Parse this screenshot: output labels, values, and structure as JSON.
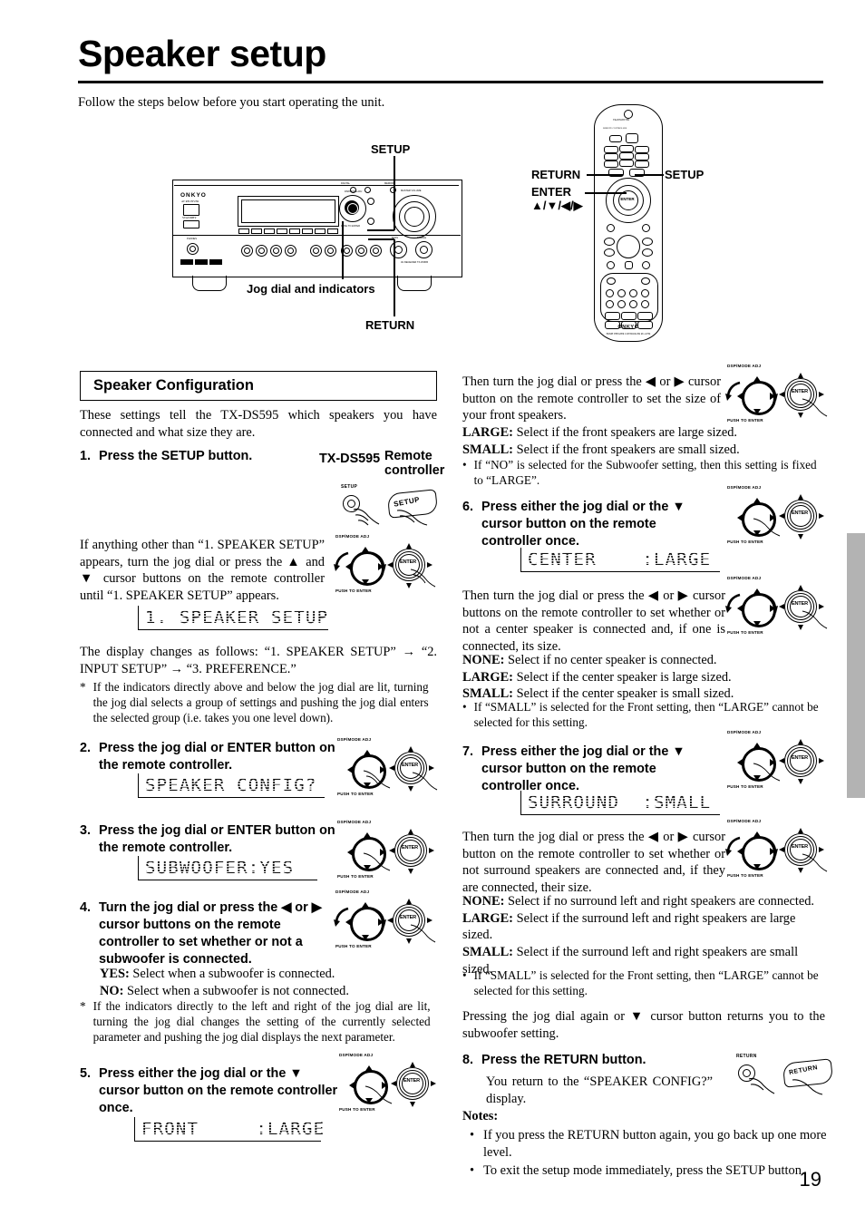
{
  "document": {
    "title": "Speaker setup",
    "intro": "Follow the steps below before you start operating the unit.",
    "page_number": "19"
  },
  "diagrams": {
    "receiver": {
      "brand": "ONKYO",
      "model": "TX-DS595",
      "callout_setup": "SETUP",
      "callout_jog": "Jog dial and indicators",
      "callout_return": "RETURN"
    },
    "remote": {
      "brand": "ONKYO",
      "callout_return": "RETURN",
      "callout_enter": "ENTER",
      "callout_cursor": "▲/▼/◀/▶",
      "callout_setup": "SETUP"
    },
    "jog_icon": {
      "top_label": "DSP/MODE ADJ",
      "bottom_label": "PUSH TO ENTER",
      "enter_label": "ENTER"
    },
    "setup_button_icon": {
      "label": "SETUP",
      "keycap": "SETUP"
    },
    "return_button_icon": {
      "label": "RETURN",
      "keycap": "RETURN"
    }
  },
  "left_column": {
    "section_header": "Speaker Configuration",
    "section_intro": "These settings tell the TX-DS595 which speakers you have connected and what size they are.",
    "device_label": "TX-DS595",
    "remote_label_line1": "Remote",
    "remote_label_line2": "controller",
    "step1": {
      "number": "1.",
      "heading": "Press the SETUP button.",
      "body": "If anything other than “1. SPEAKER SETUP” appears, turn the jog dial or press the ▲ and ▼ cursor buttons on the remote controller until “1. SPEAKER SETUP” appears.",
      "display": "1. SPEAKER SETUP",
      "after1": "The display changes as follows: “1. SPEAKER SETUP” → “2. INPUT SETUP” → “3. PREFERENCE.”",
      "after2_marker": "*",
      "after2": "If the indicators directly above and below the jog dial are lit, turning the jog dial selects a group of settings and pushing the jog dial enters the selected group (i.e. takes you one level down)."
    },
    "step2": {
      "number": "2.",
      "heading": "Press the jog dial or ENTER button on the remote controller.",
      "display": "SPEAKER CONFIG?"
    },
    "step3": {
      "number": "3.",
      "heading": "Press the jog dial or ENTER button on the remote controller.",
      "display": "SUBWOOFER:YES"
    },
    "step4": {
      "number": "4.",
      "heading": "Turn the jog dial or press the ◀ or ▶ cursor buttons on the remote controller to set whether or not a subwoofer is connected.",
      "opt1_key": "YES:",
      "opt1_text": " Select when a subwoofer is connected.",
      "opt2_key": "NO:",
      "opt2_text": " Select when a subwoofer is not connected.",
      "note_marker": "*",
      "note": "If the indicators directly to the left and right of the jog dial are lit, turning the jog dial changes the setting of the currently selected parameter and pushing the jog dial displays the next parameter."
    },
    "step5": {
      "number": "5.",
      "heading": "Press either the jog dial or the ▼ cursor button on the remote controller once.",
      "display": "FRONT     :LARGE"
    }
  },
  "right_column": {
    "front": {
      "body": "Then turn the jog dial or press the ◀ or ▶ cursor button on the remote controller to set the size of your front speakers.",
      "opt1_key": "LARGE:",
      "opt1_text": " Select if the front speakers are large sized.",
      "opt2_key": "SMALL:",
      "opt2_text": " Select if the front speakers are small sized.",
      "bullet": "If “NO” is selected for the Subwoofer setting, then this setting is fixed to “LARGE”."
    },
    "step6": {
      "number": "6.",
      "heading": "Press either the jog dial or the ▼ cursor button on the remote controller once.",
      "display": "CENTER    :LARGE",
      "body": "Then turn the jog dial or press the ◀ or ▶ cursor buttons on the remote controller to set whether or not a center speaker is connected and, if one is connected, its size.",
      "opt1_key": "NONE:",
      "opt1_text": " Select if no center speaker is connected.",
      "opt2_key": "LARGE:",
      "opt2_text": " Select if the center speaker is large sized.",
      "opt3_key": "SMALL:",
      "opt3_text": " Select if the center speaker is small sized.",
      "bullet": "If “SMALL” is selected for the Front setting, then “LARGE” cannot be selected for this setting."
    },
    "step7": {
      "number": "7.",
      "heading": "Press either the jog dial or the ▼ cursor button on the remote controller once.",
      "display": "SURROUND  :SMALL",
      "body": "Then turn the jog dial or press the ◀ or ▶ cursor button on the remote controller to set whether or not surround speakers are connected and, if they are connected, their size.",
      "opt1_key": "NONE:",
      "opt1_text": " Select if no surround left and right speakers are connected.",
      "opt2_key": "LARGE:",
      "opt2_text": " Select if the surround left and right speakers are large sized.",
      "opt3_key": "SMALL:",
      "opt3_text": " Select if the surround left and right speakers are small sized.",
      "bullet": "If “SMALL” is selected for the Front setting, then “LARGE” cannot be selected for this setting.",
      "closing": "Pressing the jog dial again or ▼ cursor button returns you to the subwoofer setting."
    },
    "step8": {
      "number": "8.",
      "heading": "Press the RETURN button.",
      "body": "You return to the “SPEAKER CONFIG?” display."
    },
    "notes": {
      "title": "Notes:",
      "items": [
        "If you press the RETURN button again, you go back up one more level.",
        "To exit the setup mode immediately, press the SETUP button."
      ]
    }
  }
}
